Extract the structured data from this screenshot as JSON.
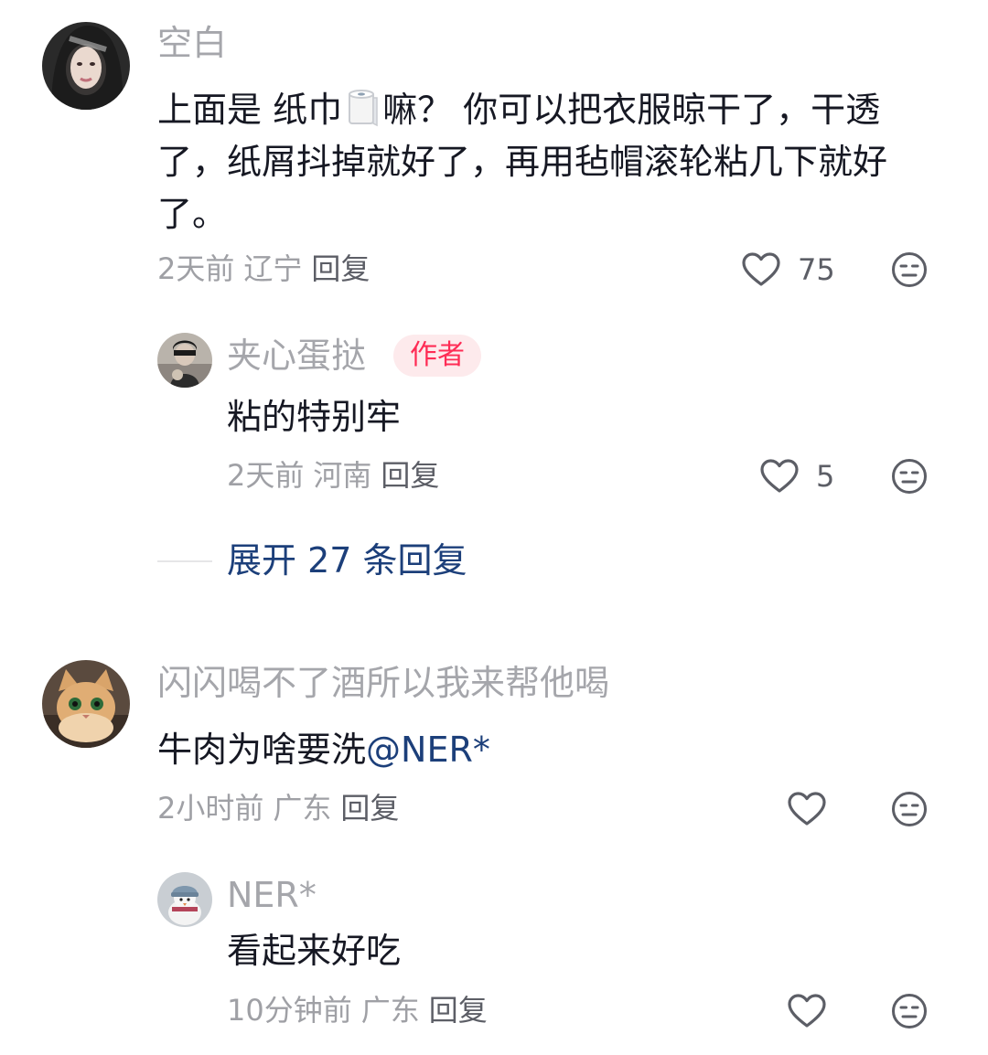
{
  "comments": [
    {
      "username": "空白",
      "text_before": "上面是 纸巾",
      "text_after": "嘛？ 你可以把衣服晾干了，干透了，纸屑抖掉就好了，再用毡帽滚轮粘几下就好了。",
      "icon": "toilet-paper-emoji",
      "time": "2天前",
      "location": "辽宁",
      "reply_label": "回复",
      "likes": "75",
      "replies": [
        {
          "username": "夹心蛋挞",
          "badge": "作者",
          "text": "粘的特别牢",
          "time": "2天前",
          "location": "河南",
          "reply_label": "回复",
          "likes": "5"
        }
      ],
      "expand_label": "展开 27 条回复"
    },
    {
      "username": "闪闪喝不了酒所以我来帮他喝",
      "text": "牛肉为啥要洗",
      "mention": "@NER*",
      "time": "2小时前",
      "location": "广东",
      "reply_label": "回复",
      "likes": "",
      "replies": [
        {
          "username": "NER*",
          "text": "看起来好吃",
          "time": "10分钟前",
          "location": "广东",
          "reply_label": "回复",
          "likes": ""
        }
      ]
    }
  ],
  "colors": {
    "username": "#a5a6ab",
    "text": "#161823",
    "meta": "#9fa0a5",
    "link": "#1c3f7a",
    "author_badge_bg": "#fdeaec",
    "author_badge_text": "#fe2c55"
  }
}
